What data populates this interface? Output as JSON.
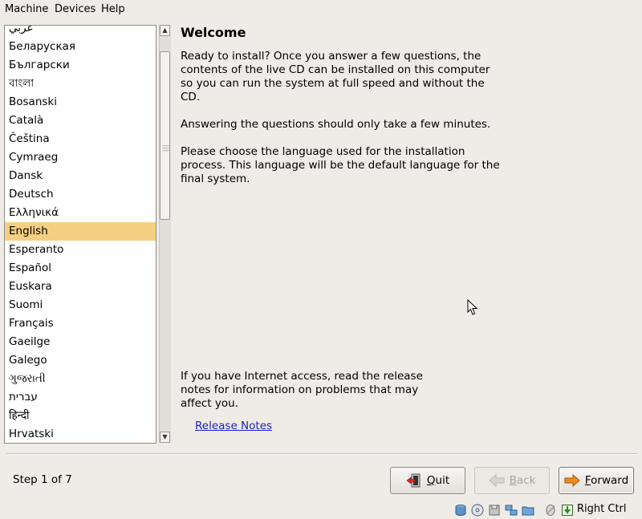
{
  "menubar": {
    "items": [
      "Machine",
      "Devices",
      "Help"
    ]
  },
  "languages": {
    "items": [
      "عربي",
      "Беларуская",
      "Български",
      "বাংলা",
      "Bosanski",
      "Català",
      "Čeština",
      "Cymraeg",
      "Dansk",
      "Deutsch",
      "Ελληνικά",
      "English",
      "Esperanto",
      "Español",
      "Euskara",
      "Suomi",
      "Français",
      "Gaeilge",
      "Galego",
      "ગુજરાતી",
      "עברית",
      "हिन्दी",
      "Hrvatski"
    ],
    "selected": "English"
  },
  "welcome": {
    "title": "Welcome",
    "para1": "Ready to install? Once you answer a few questions, the\ncontents of the live CD can be installed on this computer\nso you can run the system at full speed and without the\nCD.",
    "para2": "Answering the questions should only take a few minutes.",
    "para3": "Please choose the language used for the installation\nprocess. This language will be the default language for the\nfinal system.",
    "para4": "If you have Internet access, read the release\nnotes for information on problems that may\naffect you.",
    "release_notes_link": "Release Notes"
  },
  "footer": {
    "step": "Step 1 of 7",
    "quit_label": "Quit",
    "back_label": "Back",
    "forward_label": "Forward"
  },
  "statusbar": {
    "icons": [
      "hard-disk-icon",
      "cd-icon",
      "floppy-icon",
      "network-icon",
      "shared-folder-icon",
      "mouse-integration-icon",
      "host-key-icon"
    ],
    "host_key": "Right Ctrl"
  },
  "colors": {
    "selection": "#f5cf82",
    "link": "#1a20c7",
    "background": "#efebe7"
  }
}
